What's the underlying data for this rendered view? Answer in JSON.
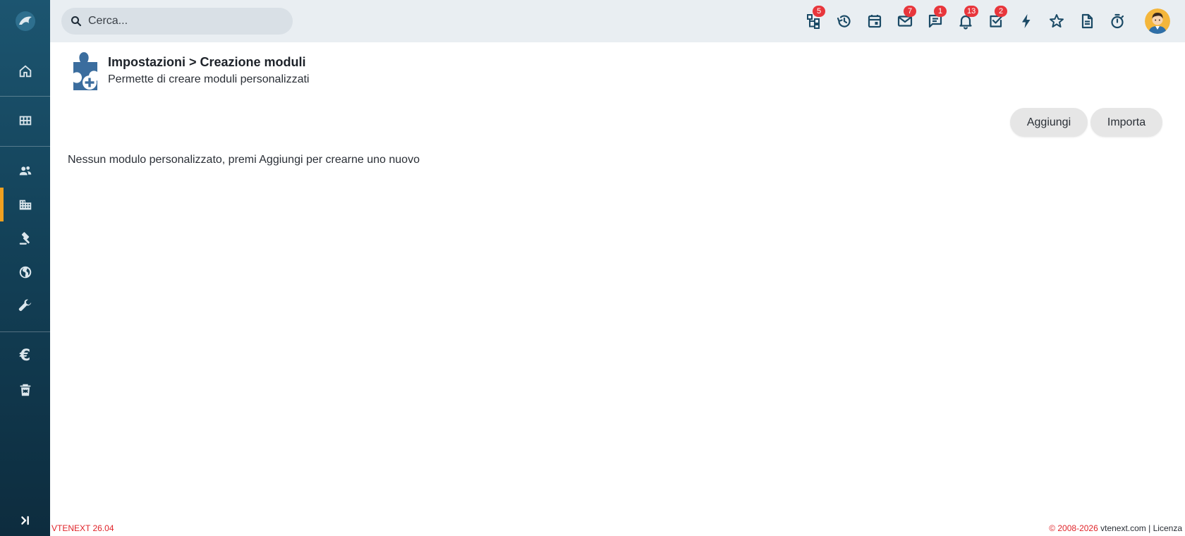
{
  "search": {
    "placeholder": "Cerca..."
  },
  "topbar": {
    "badges": {
      "processes": "5",
      "messages": "7",
      "chat": "1",
      "notifications": "13",
      "tasks": "2"
    }
  },
  "page": {
    "title": "Impostazioni > Creazione moduli",
    "subtitle": "Permette di creare moduli personalizzati"
  },
  "actions": {
    "add_label": "Aggiungi",
    "import_label": "Importa"
  },
  "content": {
    "empty_message": "Nessun modulo personalizzato, premi Aggiungi per crearne uno nuovo"
  },
  "sidebar": {
    "euro_symbol": "€"
  },
  "footer": {
    "version": "VTENEXT 26.04",
    "copyright": "© 2008-2026",
    "site": "vtenext.com",
    "separator": "|",
    "license": "Licenza"
  },
  "colors": {
    "sidebar_top": "#1c5570",
    "sidebar_bottom": "#0d2c3e",
    "accent": "#f0a020",
    "badge": "#e8363c",
    "icon": "#1b4a66",
    "footer_text": "#e0242a"
  }
}
